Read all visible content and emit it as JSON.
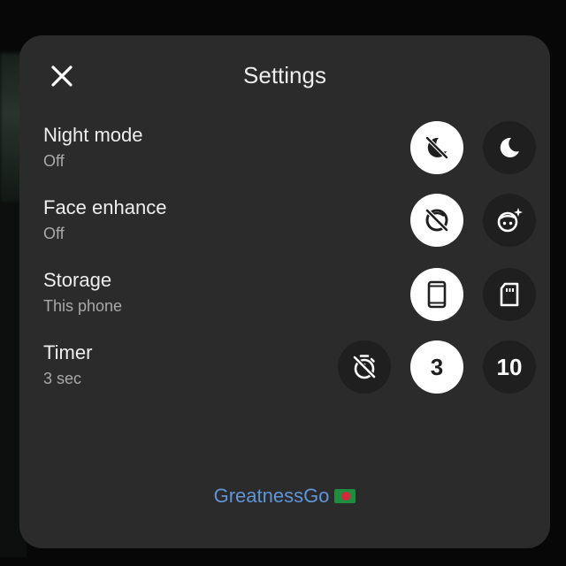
{
  "dialog": {
    "title": "Settings"
  },
  "settings": [
    {
      "label": "Night mode",
      "value": "Off",
      "options": [
        {
          "icon": "night-mode-off-icon",
          "selected": true
        },
        {
          "icon": "moon-icon",
          "selected": false
        }
      ]
    },
    {
      "label": "Face enhance",
      "value": "Off",
      "options": [
        {
          "icon": "face-enhance-off-icon",
          "selected": true
        },
        {
          "icon": "face-sparkle-icon",
          "selected": false
        }
      ]
    },
    {
      "label": "Storage",
      "value": "This phone",
      "options": [
        {
          "icon": "phone-icon",
          "selected": true
        },
        {
          "icon": "sd-card-icon",
          "selected": false
        }
      ]
    },
    {
      "label": "Timer",
      "value": "3 sec",
      "options": [
        {
          "icon": "timer-off-icon",
          "selected": false
        },
        {
          "text": "3",
          "selected": true
        },
        {
          "text": "10",
          "selected": false
        }
      ]
    }
  ],
  "watermark": {
    "text": "GreatnessGo",
    "flag_icon": "bangladesh-flag-icon"
  },
  "colors": {
    "panel": "#2b2b2c",
    "selected": "#ffffff",
    "unselected": "#1f1f20",
    "watermark": "#5f95d6"
  }
}
